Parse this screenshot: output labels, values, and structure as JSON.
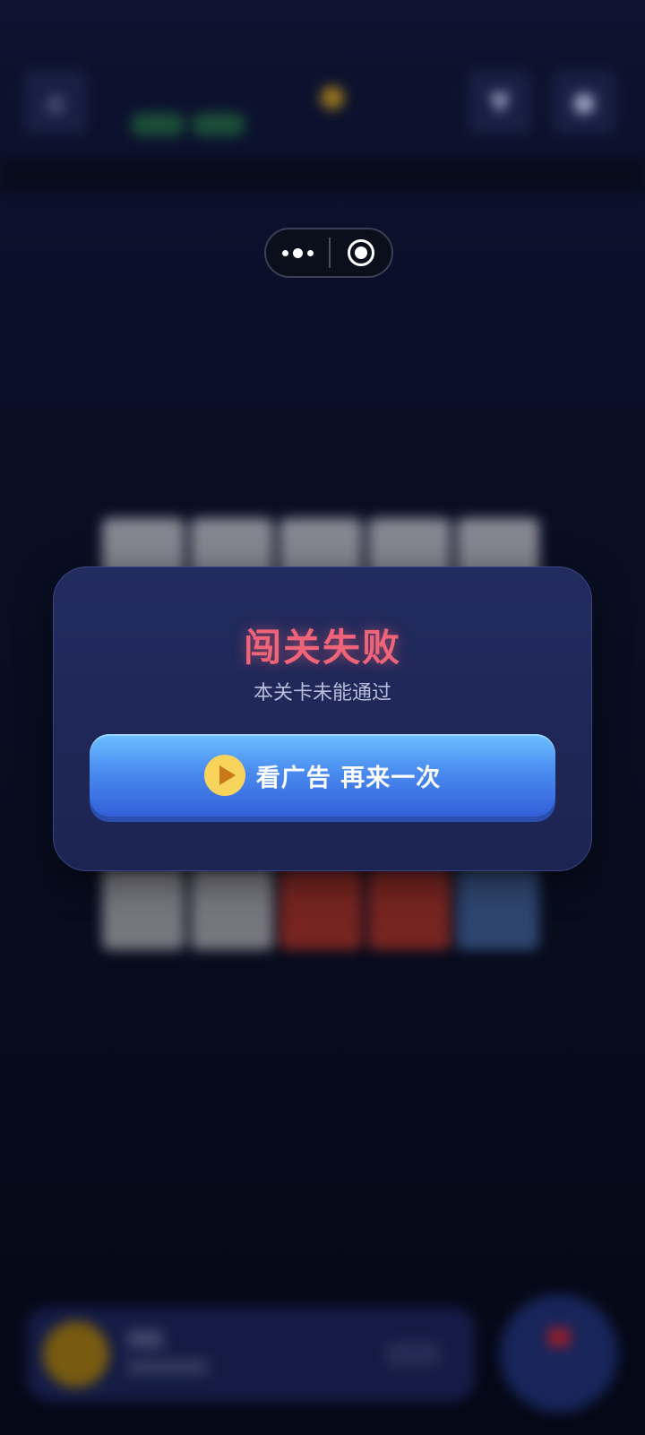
{
  "capsule": {
    "more_icon": "more-dots-icon",
    "close_icon": "target-close-icon"
  },
  "dialog": {
    "title": "闯关失败",
    "subtitle": "本关卡未能通过",
    "retry_button": {
      "icon": "play-icon",
      "label": "看广告 再来一次"
    }
  },
  "colors": {
    "title": "#ef6478",
    "button_top": "#6cc0ff",
    "button_bottom": "#3360d8",
    "play_icon_bg": "#f8d45c"
  }
}
